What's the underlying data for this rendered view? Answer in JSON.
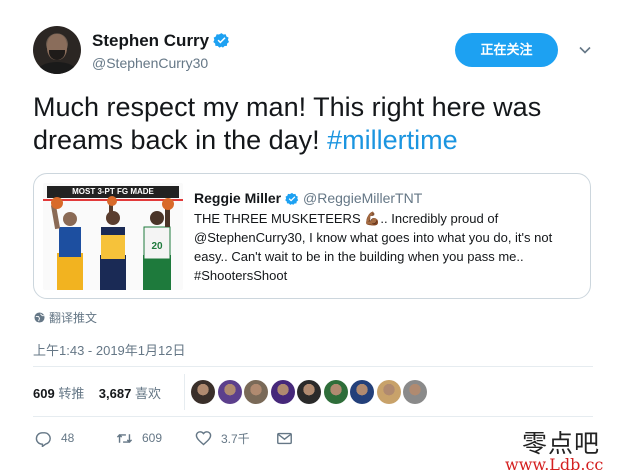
{
  "author": {
    "name": "Stephen Curry",
    "handle": "@StephenCurry30",
    "verified": true,
    "follow_label": "正在关注"
  },
  "tweet": {
    "text": "Much respect my man! This right here was dreams back in the day! ",
    "hashtag": "#millertime"
  },
  "quoted": {
    "name": "Reggie Miller",
    "handle": "@ReggieMillerTNT",
    "verified": true,
    "image_banner": "MOST 3-PT FG MADE",
    "text": "THE THREE MUSKETEERS 💪🏾.. Incredibly proud of @StephenCurry30, I know what goes into what you do, it's not easy.. Can't wait to be in the building when you pass me.. #ShootersShoot"
  },
  "translate_label": "翻译推文",
  "timestamp": "上午1:43 - 2019年1月12日",
  "stats": {
    "retweets": "609",
    "retweets_label": "转推",
    "likes": "3,687",
    "likes_label": "喜欢"
  },
  "likers": [
    {
      "color": "#3a2f2a"
    },
    {
      "color": "#5c3f8c"
    },
    {
      "color": "#7a6a58"
    },
    {
      "color": "#46287a"
    },
    {
      "color": "#2a2a2a"
    },
    {
      "color": "#2f6e3a"
    },
    {
      "color": "#23407a"
    },
    {
      "color": "#c8a26a"
    },
    {
      "color": "#8a8a8a"
    }
  ],
  "actions": {
    "reply_count": "48",
    "retweet_count": "609",
    "like_count": "3.7千"
  },
  "watermark": {
    "line1": "零点吧",
    "line2": "www.Ldb.cc"
  },
  "colors": {
    "accent": "#1da1f2",
    "hashtag": "#1b95e0",
    "secondary_text": "#657786"
  }
}
